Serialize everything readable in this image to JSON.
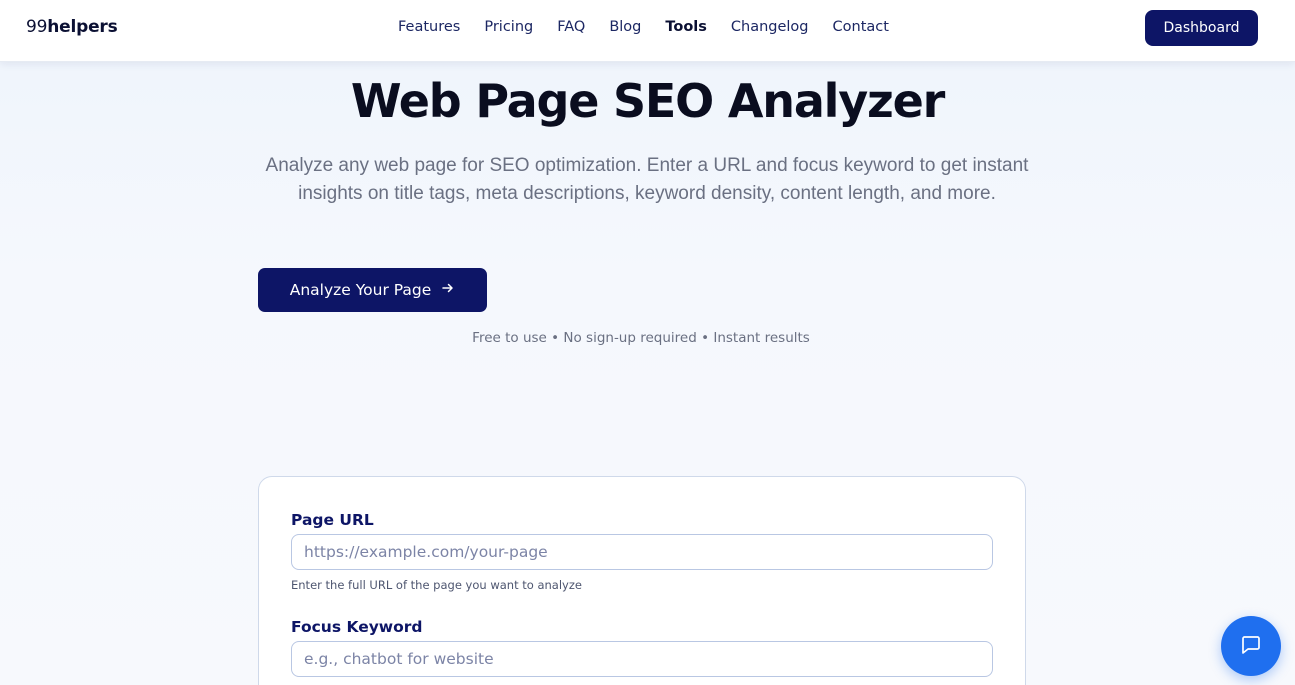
{
  "brand": {
    "prefix": "99",
    "name": "helpers"
  },
  "nav": {
    "items": [
      {
        "label": "Features"
      },
      {
        "label": "Pricing"
      },
      {
        "label": "FAQ"
      },
      {
        "label": "Blog"
      },
      {
        "label": "Tools",
        "active": true
      },
      {
        "label": "Changelog"
      },
      {
        "label": "Contact"
      }
    ],
    "dashboard_label": "Dashboard"
  },
  "hero": {
    "title": "Web Page SEO Analyzer",
    "subtitle": "Analyze any web page for SEO optimization. Enter a URL and focus keyword to get instant insights on title tags, meta descriptions, keyword density, content length, and more.",
    "cta_label": "Analyze Your Page",
    "cta_icon": "arrow-right-icon",
    "note": "Free to use • No sign-up required • Instant results"
  },
  "form": {
    "url_label": "Page URL",
    "url_value": "",
    "url_placeholder": "https://example.com/your-page",
    "url_hint": "Enter the full URL of the page you want to analyze",
    "keyword_label": "Focus Keyword",
    "keyword_value": "",
    "keyword_placeholder": "e.g., chatbot for website"
  },
  "chat": {
    "icon": "chat-bubble-icon"
  },
  "colors": {
    "primary": "#0d1566",
    "chat": "#1f6fef",
    "muted_text": "#6a7082"
  }
}
